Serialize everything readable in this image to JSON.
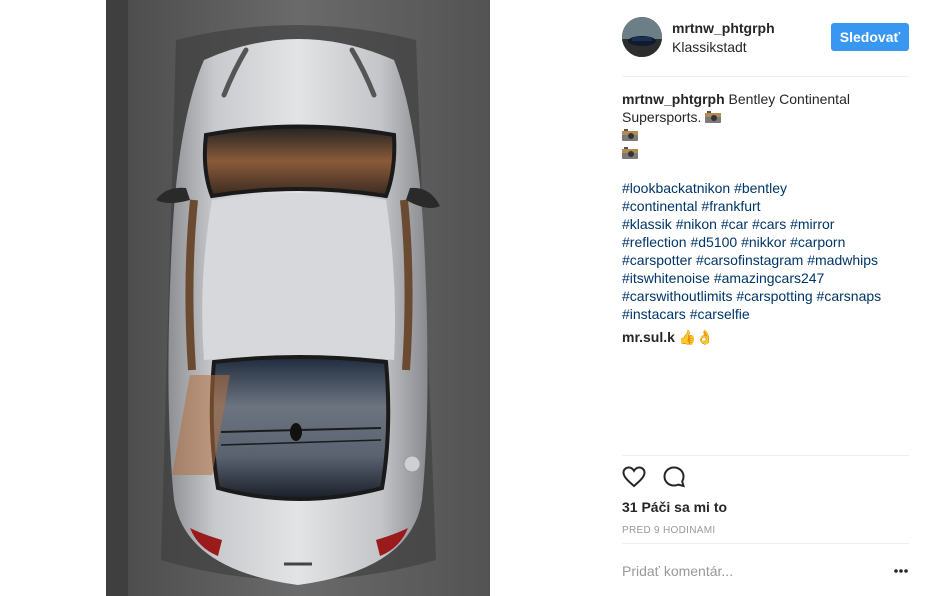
{
  "post": {
    "username": "mrtnw_phtgrph",
    "location": "Klassikstadt",
    "follow_label": "Sledovať",
    "caption_user": "mrtnw_phtgrph",
    "caption_text": " Bentley Continental Supersports. ",
    "hashtags": [
      "#lookbackatnikon",
      "#bentley",
      "#continental",
      "#frankfurt",
      "#klassik",
      "#nikon",
      "#car",
      "#cars",
      "#mirror",
      "#reflection",
      "#d5100",
      "#nikkor",
      "#carporn",
      "#carspotter",
      "#carsofinstagram",
      "#madwhips",
      "#itswhitenoise",
      "#amazingcars247",
      "#carswithoutlimits",
      "#carspotting",
      "#carsnaps",
      "#instacars",
      "#carselfie"
    ],
    "comment_user": "mr.sul.k",
    "comment_emoji": "👍👌",
    "likes": "31 Páči sa mi to",
    "timestamp": "PRED 9 HODINAMI",
    "add_comment_placeholder": "Pridať komentár...",
    "link_color": "#003569",
    "button_color": "#3897f0"
  }
}
